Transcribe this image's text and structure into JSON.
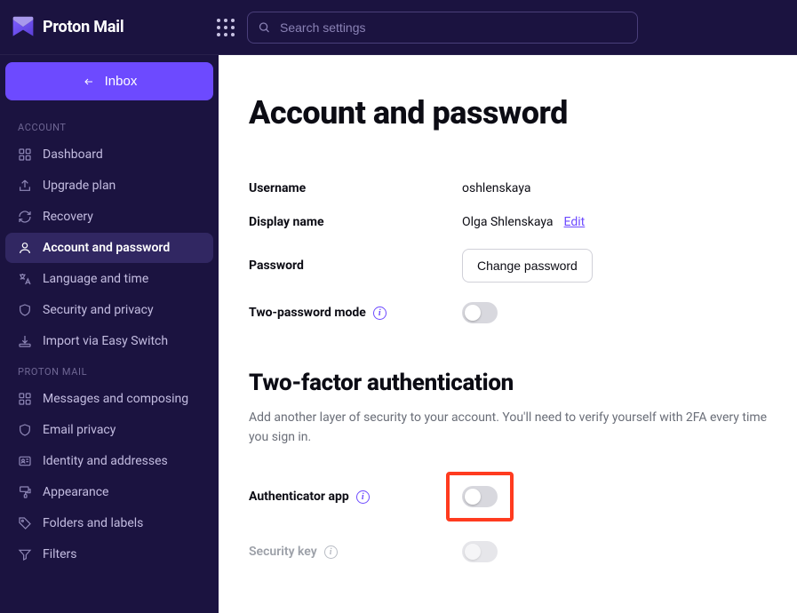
{
  "brand": {
    "name": "Proton Mail"
  },
  "search": {
    "placeholder": "Search settings"
  },
  "inbox_button": {
    "label": "Inbox"
  },
  "sidebar": {
    "sections": [
      {
        "label": "ACCOUNT",
        "items": [
          {
            "label": "Dashboard",
            "icon": "grid"
          },
          {
            "label": "Upgrade plan",
            "icon": "arrow-up-box"
          },
          {
            "label": "Recovery",
            "icon": "refresh"
          },
          {
            "label": "Account and password",
            "icon": "user",
            "active": true
          },
          {
            "label": "Language and time",
            "icon": "translate"
          },
          {
            "label": "Security and privacy",
            "icon": "shield"
          },
          {
            "label": "Import via Easy Switch",
            "icon": "import"
          }
        ]
      },
      {
        "label": "PROTON MAIL",
        "items": [
          {
            "label": "Messages and composing",
            "icon": "grid"
          },
          {
            "label": "Email privacy",
            "icon": "shield"
          },
          {
            "label": "Identity and addresses",
            "icon": "id-card"
          },
          {
            "label": "Appearance",
            "icon": "paint"
          },
          {
            "label": "Folders and labels",
            "icon": "tag"
          },
          {
            "label": "Filters",
            "icon": "filter"
          }
        ]
      }
    ]
  },
  "page": {
    "title": "Account and password",
    "fields": {
      "username": {
        "label": "Username",
        "value": "oshlenskaya"
      },
      "display_name": {
        "label": "Display name",
        "value": "Olga Shlenskaya",
        "edit": "Edit"
      },
      "password": {
        "label": "Password",
        "button": "Change password"
      },
      "two_password_mode": {
        "label": "Two-password mode"
      }
    },
    "two_factor": {
      "title": "Two-factor authentication",
      "description": "Add another layer of security to your account. You'll need to verify yourself with 2FA every time you sign in.",
      "authenticator_label": "Authenticator app",
      "security_key_label": "Security key"
    }
  }
}
